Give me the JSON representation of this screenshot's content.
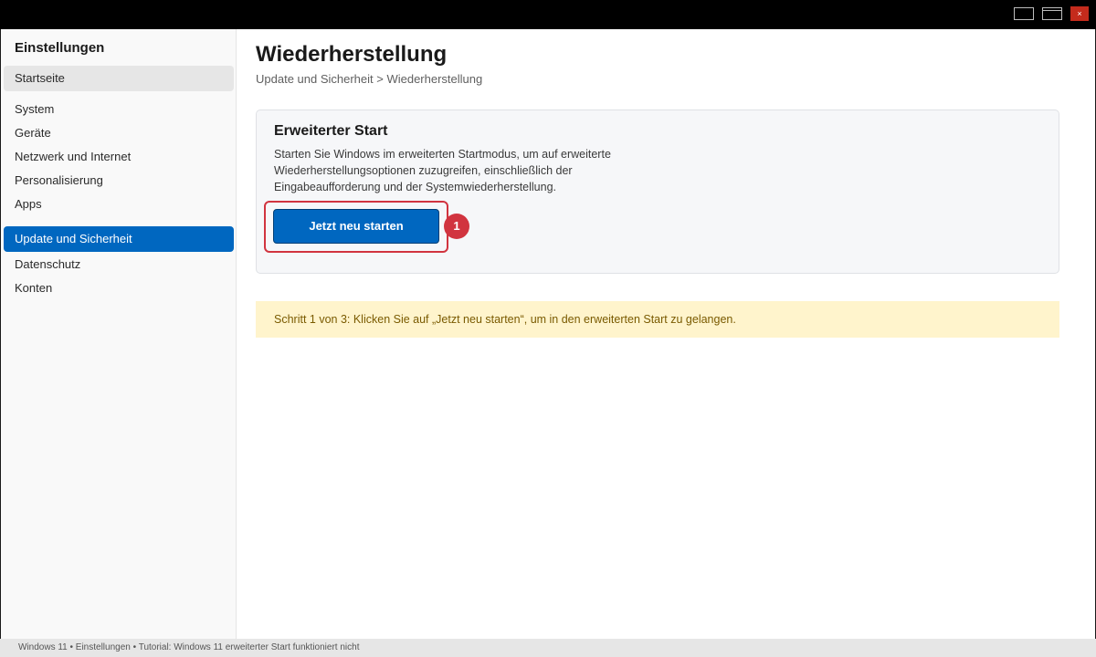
{
  "window": {
    "controls": {
      "minimize": "minimize-icon",
      "maximize": "maximize-icon",
      "close": "×"
    }
  },
  "sidebar": {
    "title": "Einstellungen",
    "items": [
      {
        "label": "Startseite"
      },
      {
        "label": "System"
      },
      {
        "label": "Geräte"
      },
      {
        "label": "Netzwerk und Internet"
      },
      {
        "label": "Personalisierung"
      },
      {
        "label": "Apps"
      },
      {
        "label": "Update und Sicherheit"
      },
      {
        "label": "Datenschutz"
      },
      {
        "label": "Konten"
      }
    ],
    "active_item": "Update und Sicherheit"
  },
  "main": {
    "title": "Wiederherstellung",
    "breadcrumb": "Update und Sicherheit > Wiederherstellung",
    "card": {
      "title": "Erweiterter Start",
      "description": "Starten Sie Windows im erweiterten Startmodus, um auf erweiterte Wiederherstellungsoptionen zuzugreifen, einschließlich der Eingabeaufforderung und der Systemwiederherstellung.",
      "button_label": "Jetzt neu starten",
      "step_badge": "1"
    },
    "notice": "Schritt 1 von 3: Klicken Sie auf „Jetzt neu starten“, um in den erweiterten Start zu gelangen."
  },
  "statusbar": {
    "text": "Windows 11 • Einstellungen • Tutorial: Windows 11 erweiterter Start funktioniert nicht"
  },
  "colors": {
    "accent": "#0067c0",
    "highlight": "#d1343f",
    "notice_bg": "#fff4cc",
    "close_button": "#c42b1c"
  }
}
